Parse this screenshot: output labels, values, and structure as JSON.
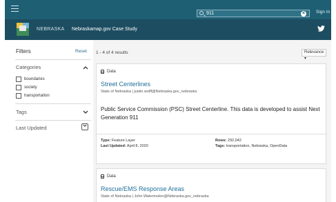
{
  "header": {
    "search_value": "911",
    "clear_label": "×",
    "signin_label": "Sign In",
    "brand": "NEBRASKA",
    "site_title": "Nebraskamap.gov Case Study",
    "twitter_glyph": "🐦"
  },
  "sidebar": {
    "filters_title": "Filters",
    "reset_label": "Reset",
    "categories_label": "Categories",
    "categories": [
      "boundaries",
      "society",
      "transportation"
    ],
    "tags_label": "Tags",
    "last_updated_label": "Last Updated"
  },
  "results": {
    "count_label": "1 - 4 of 4 results",
    "sort_label": "Relevance ▾",
    "items": [
      {
        "type": "Data",
        "title": "Street Centerlines",
        "source": "State of Nebraska | justin.wolff@Nebraska.gov_nebraska",
        "description": "Public Service Commission (PSC) Street Centerline. This data is developed to assist Next Generation 911",
        "type_label": "Type:",
        "type_value": "Feature Layer",
        "updated_label": "Last Updated:",
        "updated_value": "April 8, 2020",
        "rows_label": "Rows:",
        "rows_value": "292,042",
        "tags_label": "Tags:",
        "tags_value": "transportation, Nebraska, OpenData"
      },
      {
        "type": "Data",
        "title": "Rescue/EMS Response Areas",
        "source": "State of Nebraska | John.Watermolen@Nebraska.gov_nebraska"
      }
    ]
  },
  "icons": {
    "menu": "hamburger-icon",
    "search": "search-icon",
    "twitter": "twitter-icon",
    "dataset": "database-icon",
    "chevron_up": "▲",
    "chevron_down": "▼"
  },
  "colors": {
    "topbar": "#1f5f74",
    "subbar": "#1d4d61",
    "link": "#1f6f98"
  }
}
